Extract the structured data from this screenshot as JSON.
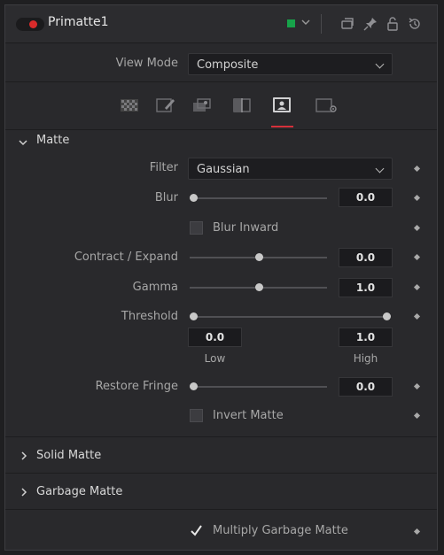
{
  "header": {
    "title": "Primatte1",
    "color_indicator": "#17a34a",
    "icons": [
      "versions-icon",
      "pin-icon",
      "lock-icon",
      "reset-icon"
    ]
  },
  "view_mode": {
    "label": "View Mode",
    "value": "Composite"
  },
  "tabs": [
    "checker-tab-icon",
    "paint-tab-icon",
    "spill-tab-icon",
    "compare-tab-icon",
    "matte-tab-icon",
    "settings-tab-icon"
  ],
  "active_tab": 4,
  "matte_section": {
    "title": "Matte",
    "expanded": true,
    "filter": {
      "label": "Filter",
      "value": "Gaussian"
    },
    "blur": {
      "label": "Blur",
      "value": "0.0",
      "level": 0.0
    },
    "blur_inward": {
      "label": "Blur Inward",
      "checked": false
    },
    "contract_expand": {
      "label": "Contract / Expand",
      "value": "0.0",
      "level": 0.5
    },
    "gamma": {
      "label": "Gamma",
      "value": "1.0",
      "level": 0.5
    },
    "threshold": {
      "label": "Threshold",
      "low_value": "0.0",
      "high_value": "1.0",
      "low_label": "Low",
      "high_label": "High"
    },
    "restore_fringe": {
      "label": "Restore Fringe",
      "value": "0.0",
      "level": 0.0
    },
    "invert_matte": {
      "label": "Invert Matte",
      "checked": false
    }
  },
  "solid_matte": {
    "title": "Solid Matte",
    "expanded": false
  },
  "garbage_matte": {
    "title": "Garbage Matte",
    "expanded": false
  },
  "multiply_garbage_matte": {
    "label": "Multiply Garbage Matte",
    "checked": true
  }
}
